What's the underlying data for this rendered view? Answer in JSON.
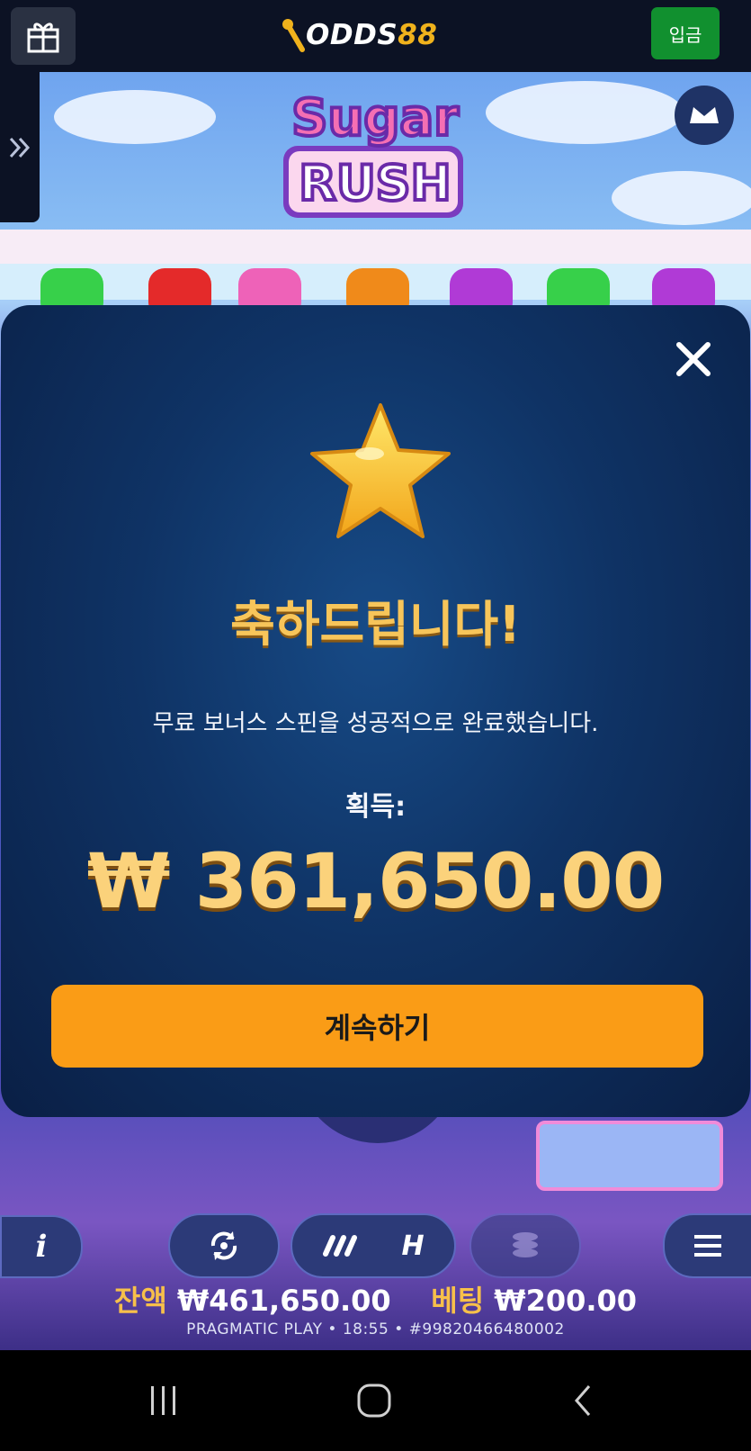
{
  "header": {
    "logo_text": "ODDS",
    "logo_number": "88",
    "deposit_label": "입금",
    "brand_color": "#f0b21c",
    "deposit_color": "#11902f"
  },
  "game": {
    "title_line1": "Sugar",
    "title_line2": "RUSH"
  },
  "modal": {
    "title": "축하드립니다!",
    "message": "무료 보너스 스핀을 성공적으로 완료했습니다.",
    "earned_label": "획득:",
    "amount": "₩ 361,650.00",
    "continue_label": "계속하기",
    "accent_color": "#fa9c16"
  },
  "controls": {
    "info_label": "i",
    "turbo_label": "H",
    "balance_label": "잔액",
    "balance_value": "₩461,650.00",
    "bet_label": "베팅",
    "bet_value": "₩200.00",
    "footer": "PRAGMATIC PLAY • 18:55 • #99820466480002"
  },
  "icons": {
    "gift": "gift-icon",
    "expand": "double-chevron-right-icon",
    "crown": "crown-icon",
    "close": "close-icon",
    "star": "star-icon",
    "autoplay": "autoplay-icon",
    "speed": "speed-icon",
    "coins": "coins-icon",
    "menu": "menu-icon",
    "nav_recent": "recent-apps-icon",
    "nav_home": "home-icon",
    "nav_back": "back-icon"
  }
}
